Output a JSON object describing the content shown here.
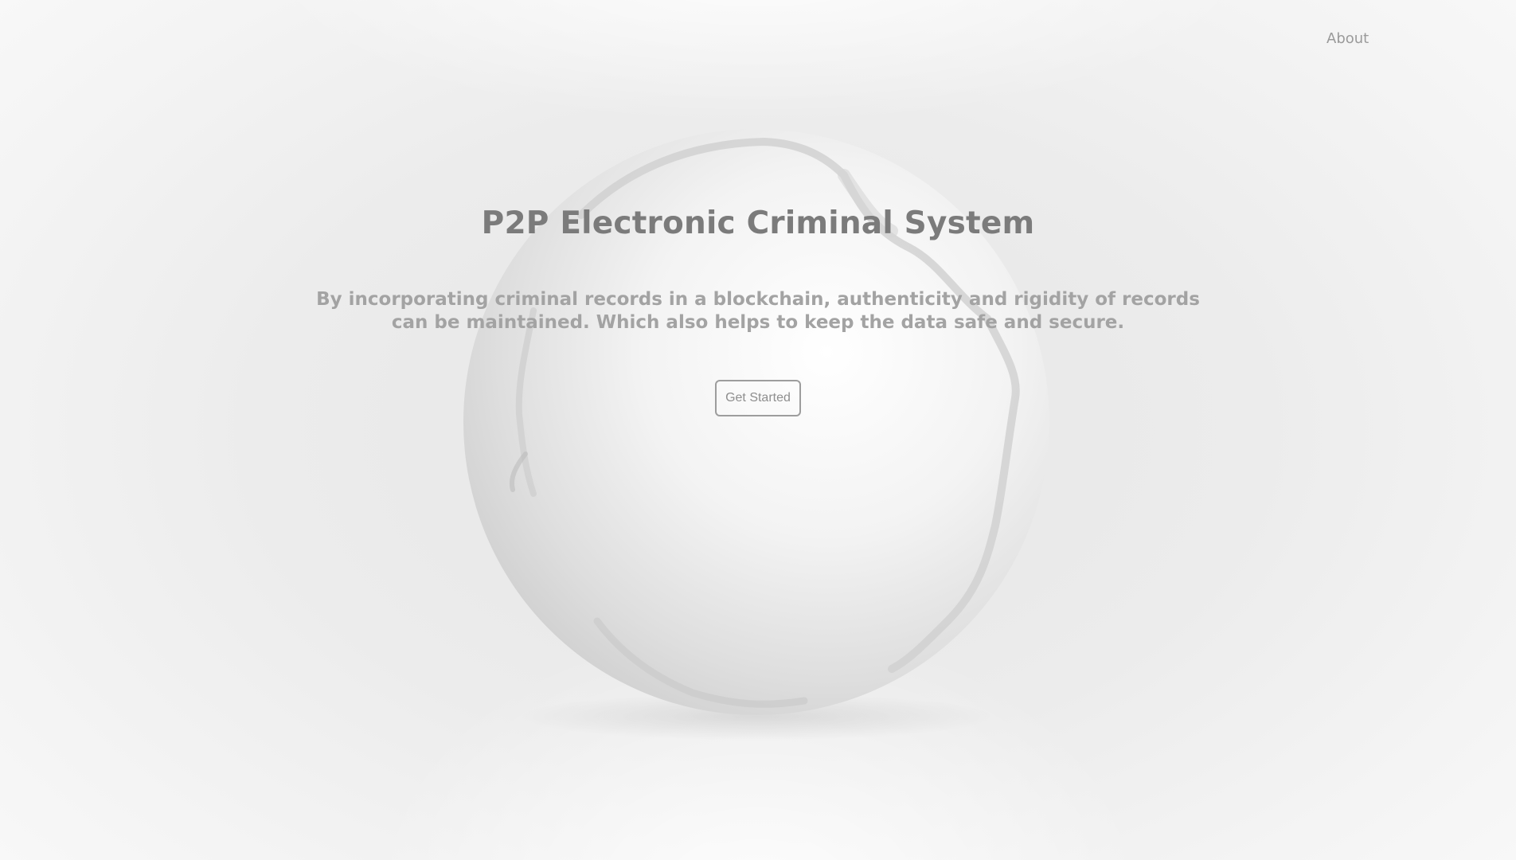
{
  "nav": {
    "about_label": "About"
  },
  "hero": {
    "title": "P2P Electronic Criminal System",
    "subtitle_line1": "By incorporating criminal records in a blockchain, authenticity and rigidity of records",
    "subtitle_line2": "can be maintained. Which also helps to keep the data safe and secure.",
    "cta_label": "Get Started"
  },
  "icons": {
    "background": "globe-icon"
  },
  "colors": {
    "title": "#7b7b7b",
    "subtitle": "#a3a3a3",
    "button_border": "#9d9d9d",
    "background": "#ececec"
  }
}
